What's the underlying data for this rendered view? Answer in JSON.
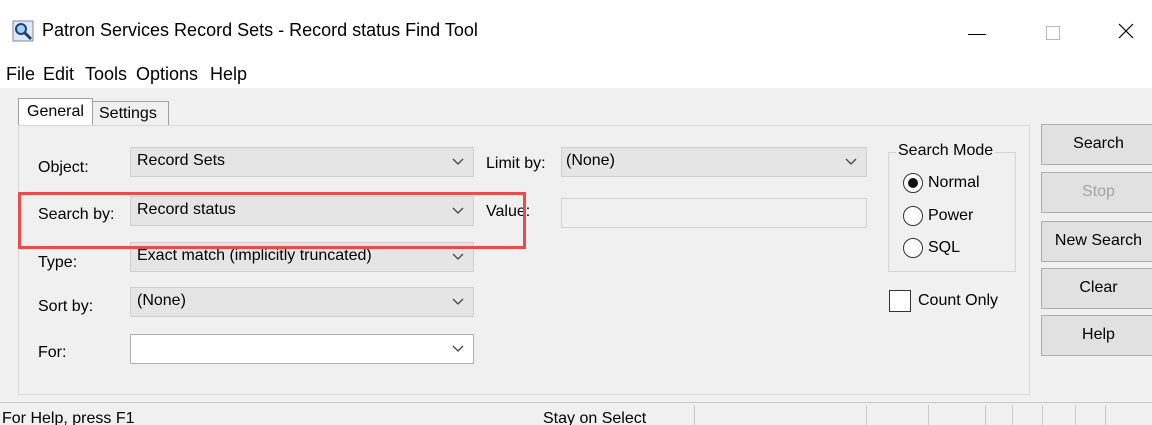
{
  "window": {
    "title": "Patron Services Record Sets - Record status Find Tool"
  },
  "menu": [
    "File",
    "Edit",
    "Tools",
    "Options",
    "Help"
  ],
  "tabs": [
    "General",
    "Settings"
  ],
  "form": {
    "object": {
      "label": "Object:",
      "value": "Record Sets"
    },
    "search_by": {
      "label": "Search by:",
      "value": "Record status"
    },
    "type": {
      "label": "Type:",
      "value": "Exact match (implicitly truncated)"
    },
    "sort_by": {
      "label": "Sort by:",
      "value": "(None)"
    },
    "for": {
      "label": "For:",
      "value": ""
    },
    "limit_by": {
      "label": "Limit by:",
      "value": "(None)"
    },
    "value": {
      "label": "Value:",
      "value": ""
    }
  },
  "search_mode": {
    "title": "Search Mode",
    "options": [
      "Normal",
      "Power",
      "SQL"
    ],
    "selected": "Normal"
  },
  "count_only": {
    "label": "Count Only",
    "checked": false
  },
  "buttons": {
    "search": "Search",
    "stop": "Stop",
    "new_search": "New Search",
    "clear": "Clear",
    "help": "Help"
  },
  "status": {
    "help_text": "For Help, press F1",
    "mode_text": "Stay on Select"
  },
  "colors": {
    "highlight": "#e84d4d"
  }
}
